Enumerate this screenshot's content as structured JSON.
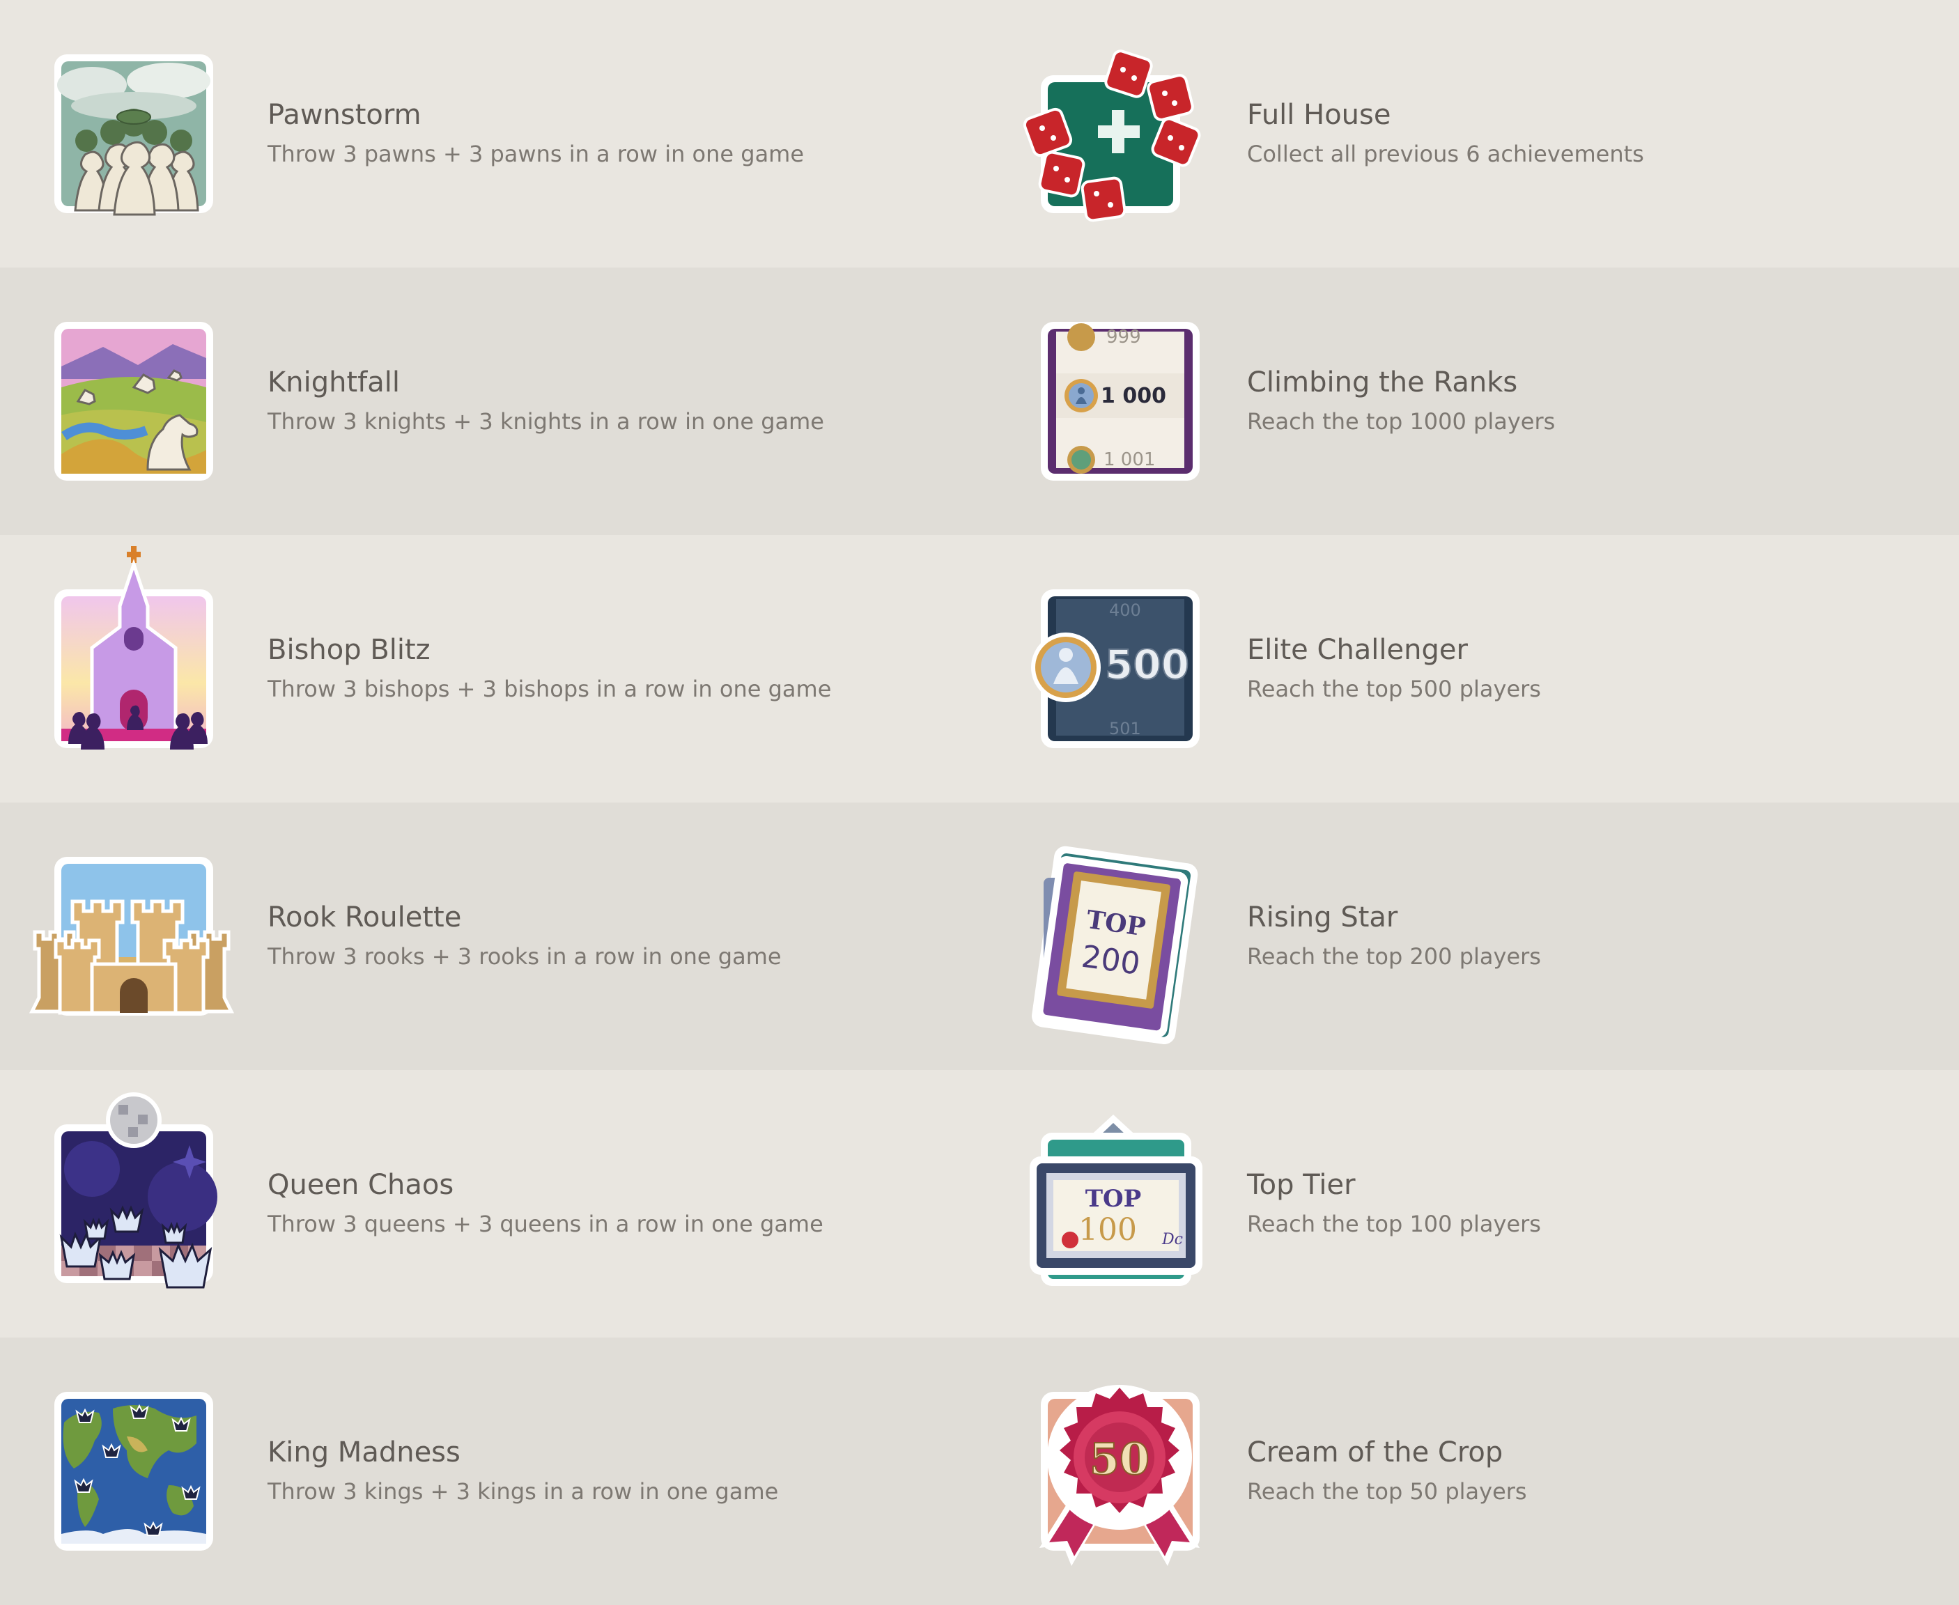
{
  "colors": {
    "background_odd": "#e9e6e0",
    "background_even": "#e0ddd7",
    "title": "#5f5a55",
    "description": "#7d7872"
  },
  "rows": [
    {
      "left": {
        "icon": "pawn-storm-icon",
        "title": "Pawnstorm",
        "description": "Throw 3 pawns + 3 pawns in a row in one game"
      },
      "right": {
        "icon": "dice-plus-icon",
        "title": "Full House",
        "description": "Collect all previous 6 achievements"
      }
    },
    {
      "left": {
        "icon": "knight-valley-icon",
        "title": "Knightfall",
        "description": "Throw 3 knights + 3 knights in a row in one game"
      },
      "right": {
        "icon": "rank-list-icon",
        "title": "Climbing the Ranks",
        "description": "Reach the top 1000 players",
        "rank_prev": "999",
        "rank_value": "1 000",
        "rank_next": "1 001"
      }
    },
    {
      "left": {
        "icon": "bishop-church-icon",
        "title": "Bishop Blitz",
        "description": "Throw 3 bishops + 3 bishops in a row in one game"
      },
      "right": {
        "icon": "rank-500-icon",
        "title": "Elite Challenger",
        "description": "Reach the top 500 players",
        "rank_prev": "400",
        "rank_value": "500",
        "rank_next": "501"
      }
    },
    {
      "left": {
        "icon": "rook-castle-icon",
        "title": "Rook Roulette",
        "description": "Throw 3 rooks + 3 rooks in a row in one game"
      },
      "right": {
        "icon": "top-200-card-icon",
        "title": "Rising Star",
        "description": "Reach the top 200 players",
        "card_top": "TOP",
        "card_value": "200"
      }
    },
    {
      "left": {
        "icon": "queen-disco-icon",
        "title": "Queen Chaos",
        "description": "Throw 3 queens + 3 queens in a row in one game"
      },
      "right": {
        "icon": "top-100-certificate-icon",
        "title": "Top Tier",
        "description": "Reach the top 100 players",
        "card_top": "TOP",
        "card_value": "100",
        "signature": "Dc"
      }
    },
    {
      "left": {
        "icon": "king-world-map-icon",
        "title": "King Madness",
        "description": "Throw 3 kings + 3 kings in a row in one game"
      },
      "right": {
        "icon": "top-50-rosette-icon",
        "title": "Cream of the Crop",
        "description": "Reach the top 50 players",
        "card_value": "50"
      }
    }
  ]
}
